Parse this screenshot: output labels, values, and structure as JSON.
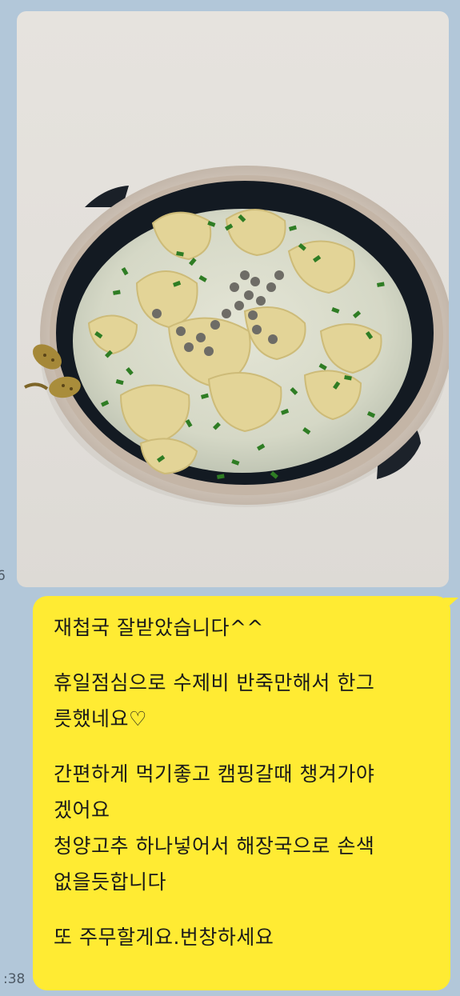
{
  "chat": {
    "photo": {
      "icon": "food-photo",
      "colors": {
        "bowl_rim": "#d8cfc6",
        "bowl_inner": "#101820",
        "broth": "#dfe0cf",
        "dumpling": "#e3d59a",
        "chives": "#2f7d24"
      }
    },
    "time_top": "6",
    "time_bottom": ":38",
    "bubble": {
      "color": "#ffeb33",
      "lines": [
        "재첩국 잘받았습니다^^",
        "",
        "휴일점심으로 수제비 반죽만해서 한그",
        "릇했네요♡",
        "",
        "간편하게 먹기좋고 캠핑갈때 챙겨가야",
        "겠어요",
        "청양고추 하나넣어서 해장국으로 손색",
        "없을듯합니다",
        "",
        "또 주무할게요.번창하세요"
      ]
    }
  }
}
